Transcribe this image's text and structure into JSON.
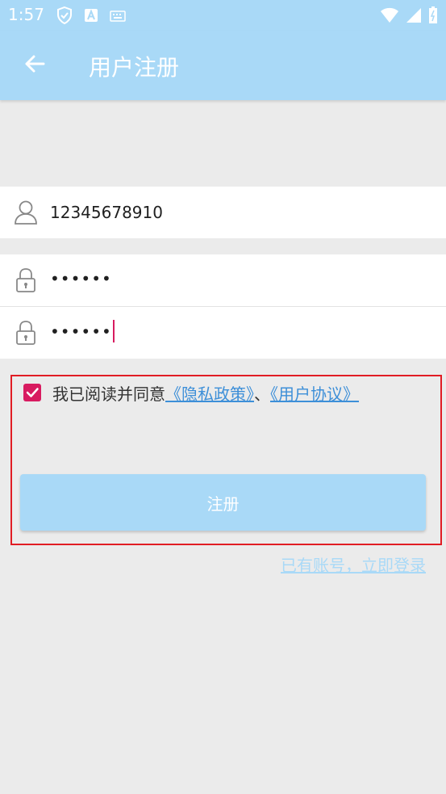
{
  "status_bar": {
    "time": "1:57",
    "icons_left": [
      "shield-check-icon",
      "a-badge-icon",
      "keyboard-icon"
    ],
    "icons_right": [
      "wifi-icon",
      "signal-icon",
      "battery-icon"
    ]
  },
  "app_bar": {
    "back_icon": "arrow-left-icon",
    "title": "用户注册",
    "background": "#a9d9f7"
  },
  "form": {
    "phone": {
      "icon": "user-icon",
      "value": "12345678910"
    },
    "password": {
      "icon": "lock-icon",
      "value": "••••••"
    },
    "confirm_password": {
      "icon": "lock-icon",
      "value": "••••••"
    }
  },
  "agreement": {
    "checked": true,
    "prefix": "我已阅读并同意",
    "privacy_link": "《隐私政策》",
    "separator": "、",
    "user_agreement_link": "《用户协议》"
  },
  "register_button": {
    "label": "注册"
  },
  "login_link": {
    "label": "已有账号，立即登录"
  },
  "colors": {
    "primary_light": "#a9d9f7",
    "accent": "#d81b60",
    "link": "#3d8fd8",
    "highlight_border": "#e11c24",
    "background": "#ebebeb"
  }
}
